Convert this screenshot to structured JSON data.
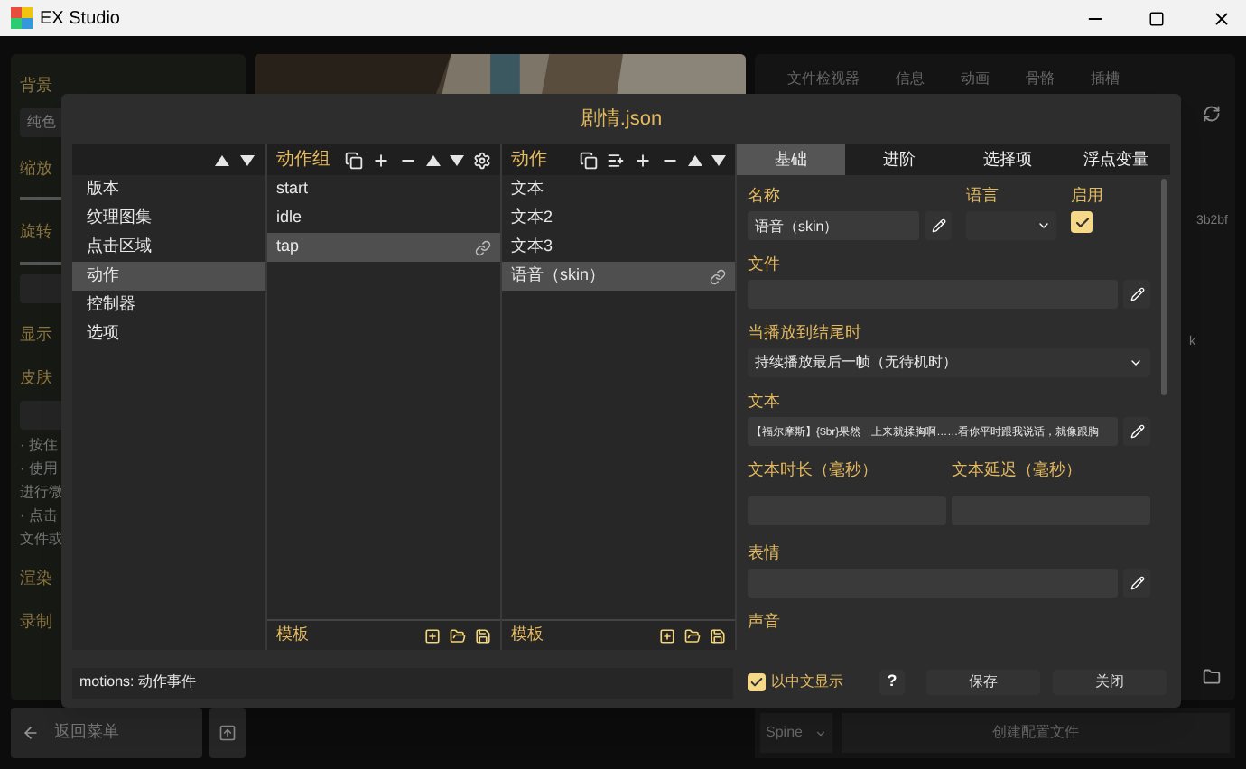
{
  "window": {
    "title": "EX Studio"
  },
  "background": {
    "left_items": [
      {
        "kind": "heading",
        "text": "背景"
      },
      {
        "kind": "field",
        "text": "纯色"
      },
      {
        "kind": "heading",
        "text": "缩放"
      },
      {
        "kind": "slider"
      },
      {
        "kind": "heading",
        "text": "旋转"
      },
      {
        "kind": "slider"
      },
      {
        "kind": "field"
      },
      {
        "kind": "heading",
        "text": "显示"
      },
      {
        "kind": "heading",
        "text": "皮肤"
      },
      {
        "kind": "field"
      },
      {
        "kind": "note",
        "text": "· 按住"
      },
      {
        "kind": "note",
        "text": "· 使用"
      },
      {
        "kind": "note",
        "text": "进行微"
      },
      {
        "kind": "note",
        "text": "· 点击"
      },
      {
        "kind": "note",
        "text": "文件或"
      },
      {
        "kind": "heading",
        "text": "渲染"
      },
      {
        "kind": "heading",
        "text": "录制"
      }
    ],
    "tabs": [
      "文件检视器",
      "信息",
      "动画",
      "骨骼",
      "插槽"
    ],
    "right_texts": [
      "3b2bf",
      "k"
    ],
    "back_button": "返回菜单",
    "runtime_select": "Spine",
    "create_button": "创建配置文件"
  },
  "dialog": {
    "title": "剧情.json",
    "categories": [
      {
        "label": "版本",
        "selected": false
      },
      {
        "label": "纹理图集",
        "selected": false
      },
      {
        "label": "点击区域",
        "selected": false
      },
      {
        "label": "动作",
        "selected": true
      },
      {
        "label": "控制器",
        "selected": false
      },
      {
        "label": "选项",
        "selected": false
      }
    ],
    "groups": {
      "title": "动作组",
      "footer": "模板",
      "items": [
        {
          "label": "start",
          "selected": false,
          "linked": false
        },
        {
          "label": "idle",
          "selected": false,
          "linked": false
        },
        {
          "label": "tap",
          "selected": true,
          "linked": true
        }
      ]
    },
    "actions": {
      "title": "动作",
      "footer": "模板",
      "items": [
        {
          "label": "文本",
          "selected": false,
          "linked": false
        },
        {
          "label": "文本2",
          "selected": false,
          "linked": false
        },
        {
          "label": "文本3",
          "selected": false,
          "linked": false
        },
        {
          "label": "语音（skin）",
          "selected": true,
          "linked": true
        }
      ]
    },
    "tabs": [
      {
        "label": "基础",
        "selected": true
      },
      {
        "label": "进阶",
        "selected": false
      },
      {
        "label": "选择项",
        "selected": false
      },
      {
        "label": "浮点变量",
        "selected": false
      }
    ],
    "form": {
      "name": {
        "label": "名称",
        "value": "语音（skin）"
      },
      "language": {
        "label": "语言"
      },
      "enabled": {
        "label": "启用",
        "checked": true
      },
      "file": {
        "label": "文件"
      },
      "on_end": {
        "label": "当播放到结尾时",
        "value": "持续播放最后一帧（无待机时）"
      },
      "text": {
        "label": "文本",
        "value": "【福尔摩斯】{$br}果然一上来就揉胸啊……看你平时跟我说话，就像跟胸"
      },
      "text_duration": {
        "label": "文本时长（毫秒）"
      },
      "text_delay": {
        "label": "文本延迟（毫秒）"
      },
      "expression": {
        "label": "表情"
      },
      "sound": {
        "label": "声音"
      }
    },
    "status": "motions: 动作事件",
    "show_chinese": {
      "label": "以中文显示",
      "checked": true
    },
    "help": "?",
    "save": "保存",
    "close": "关闭"
  }
}
